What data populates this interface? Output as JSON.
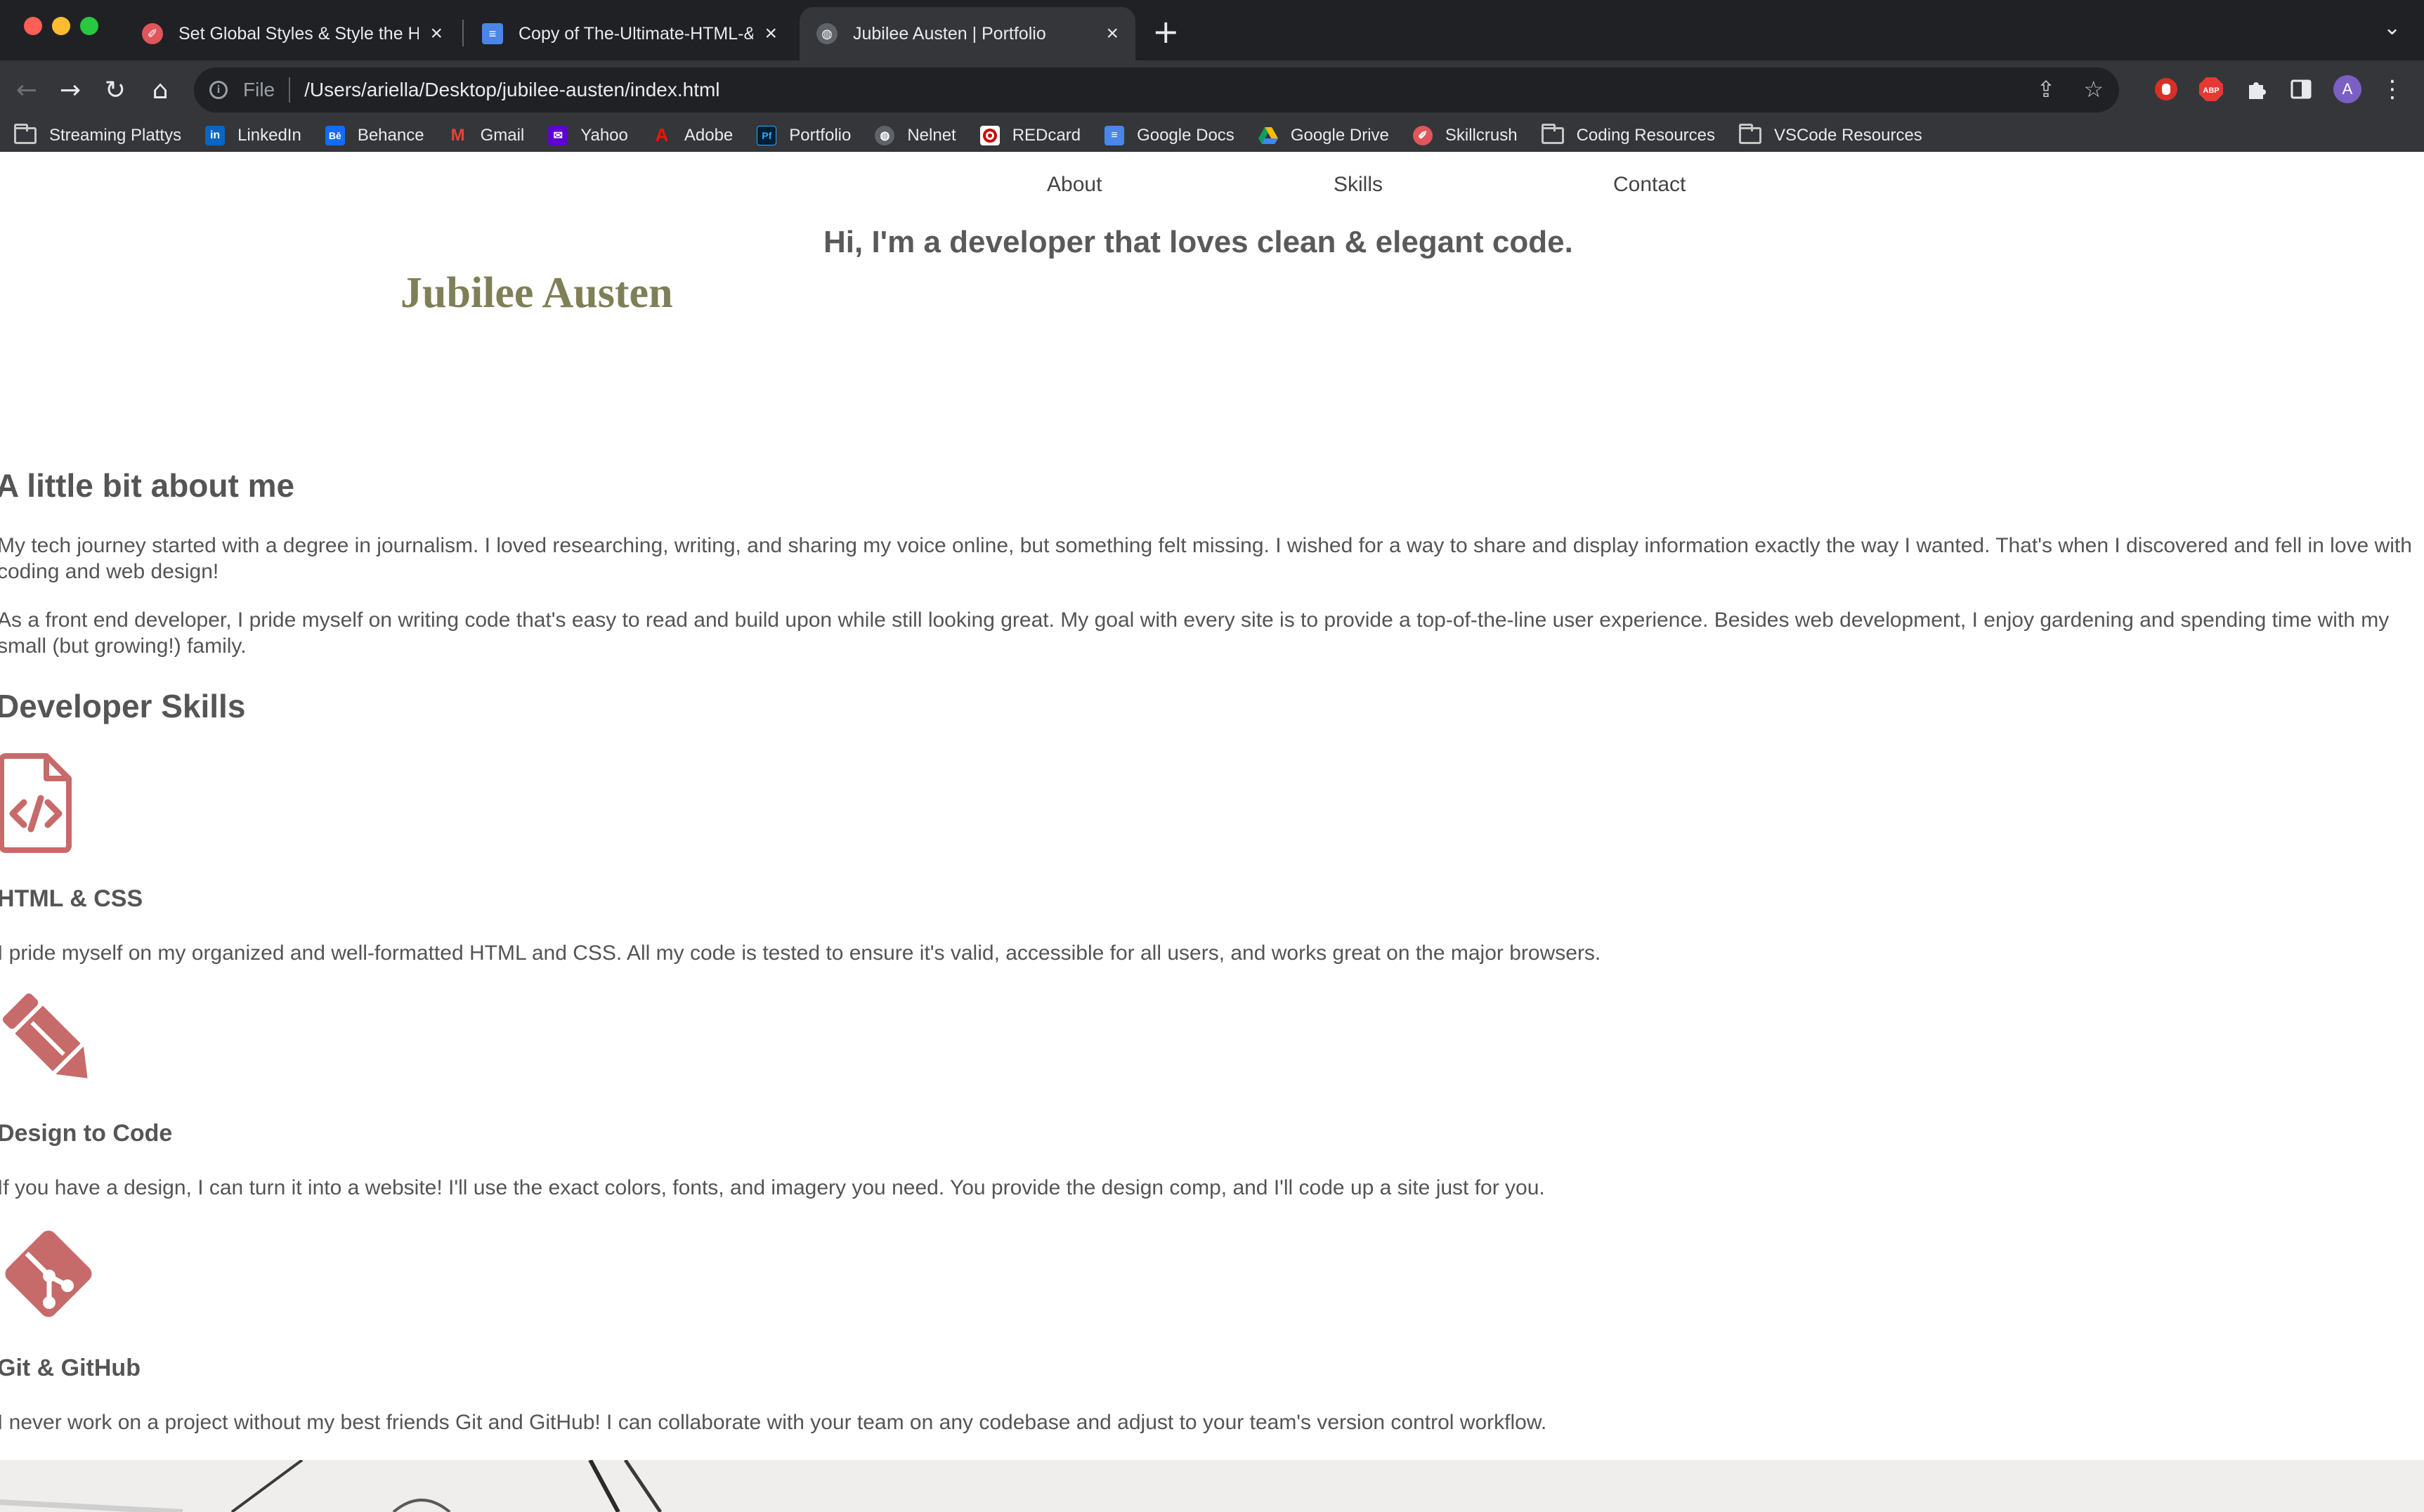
{
  "browser": {
    "tabs": [
      {
        "title": "Set Global Styles & Style the H",
        "active": false
      },
      {
        "title": "Copy of The-Ultimate-HTML-&",
        "active": false
      },
      {
        "title": "Jubilee Austen | Portfolio",
        "active": true
      }
    ],
    "address": {
      "scheme_label": "File",
      "url": "/Users/ariella/Desktop/jubilee-austen/index.html"
    },
    "profile_initial": "A",
    "bookmarks": [
      {
        "label": "Streaming Plattys",
        "icon": "folder-icon"
      },
      {
        "label": "LinkedIn",
        "icon": "linkedin-icon"
      },
      {
        "label": "Behance",
        "icon": "behance-icon"
      },
      {
        "label": "Gmail",
        "icon": "gmail-icon"
      },
      {
        "label": "Yahoo",
        "icon": "yahoo-icon"
      },
      {
        "label": "Adobe",
        "icon": "adobe-icon"
      },
      {
        "label": "Portfolio",
        "icon": "portfolio-icon"
      },
      {
        "label": "Nelnet",
        "icon": "globe-icon"
      },
      {
        "label": "REDcard",
        "icon": "target-icon"
      },
      {
        "label": "Google Docs",
        "icon": "docs-icon"
      },
      {
        "label": "Google Drive",
        "icon": "drive-icon"
      },
      {
        "label": "Skillcrush",
        "icon": "skillcrush-icon"
      },
      {
        "label": "Coding Resources",
        "icon": "folder-icon"
      },
      {
        "label": "VSCode Resources",
        "icon": "folder-icon"
      }
    ]
  },
  "site": {
    "nav": {
      "about": "About",
      "skills": "Skills",
      "contact": "Contact"
    },
    "tagline": "Hi, I'm a developer that loves clean & elegant code.",
    "brand": "Jubilee Austen",
    "about": {
      "heading": "A little bit about me",
      "p1": "My tech journey started with a degree in journalism. I loved researching, writing, and sharing my voice online, but something felt missing. I wished for a way to share and display information exactly the way I wanted. That's when I discovered and fell in love with coding and web design!",
      "p2": "As a front end developer, I pride myself on writing code that's easy to read and build upon while still looking great. My goal with every site is to provide a top-of-the-line user experience. Besides web development, I enjoy gardening and spending time with my small (but growing!) family."
    },
    "skills": {
      "heading": "Developer Skills",
      "items": [
        {
          "icon": "file-code-icon",
          "title": "HTML & CSS",
          "text": "I pride myself on my organized and well-formatted HTML and CSS. All my code is tested to ensure it's valid, accessible for all users, and works great on the major browsers."
        },
        {
          "icon": "pencil-icon",
          "title": "Design to Code",
          "text": "If you have a design, I can turn it into a website! I'll use the exact colors, fonts, and imagery you need. You provide the design comp, and I'll code up a site just for you."
        },
        {
          "icon": "git-icon",
          "title": "Git & GitHub",
          "text": "I never work on a project without my best friends Git and GitHub! I can collaborate with your team on any codebase and adjust to your team's version control workflow."
        }
      ]
    },
    "colors": {
      "brand": "#7f7f58",
      "icon": "#c76a6a",
      "text": "#545454"
    }
  }
}
